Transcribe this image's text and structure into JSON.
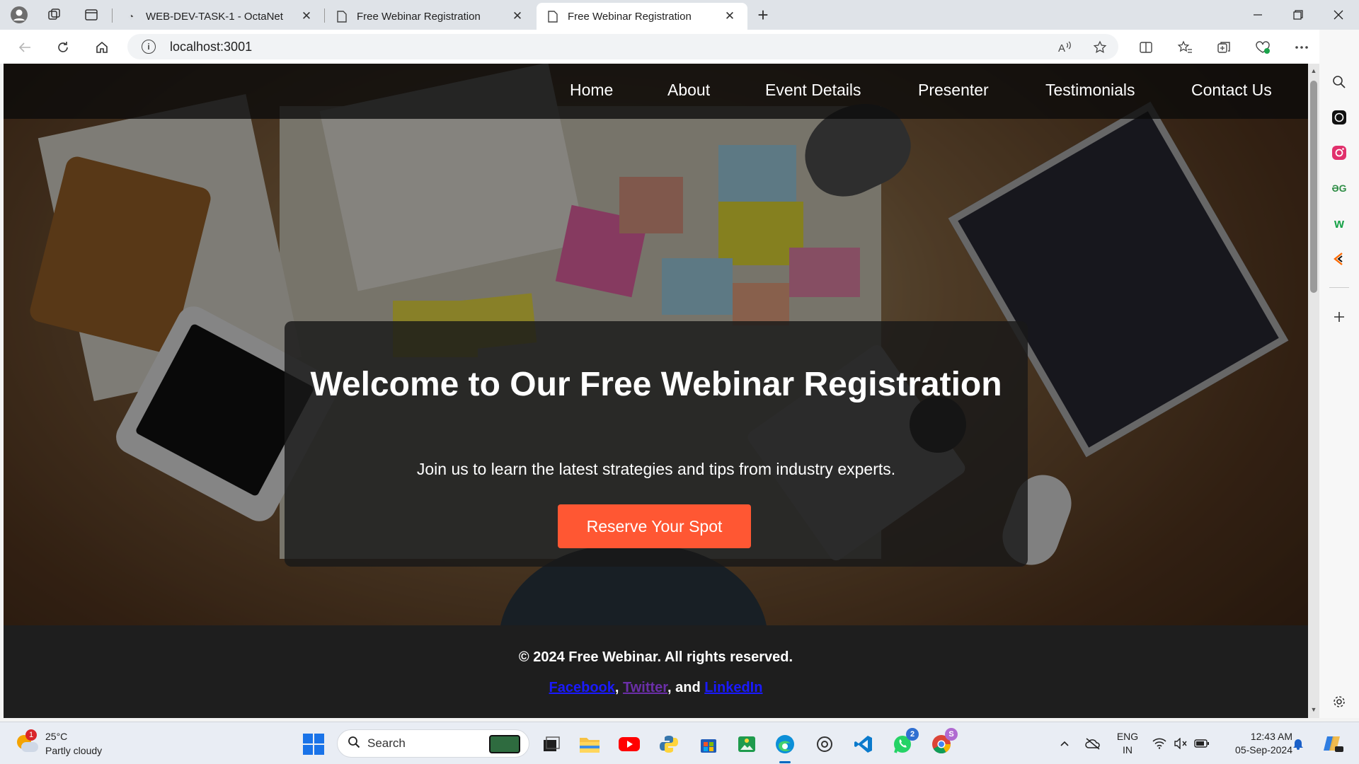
{
  "browser": {
    "tabs": [
      {
        "label": "WEB-DEV-TASK-1 - OctaNet",
        "active": false
      },
      {
        "label": "Free Webinar Registration",
        "active": false
      },
      {
        "label": "Free Webinar Registration",
        "active": true
      }
    ],
    "close_glyph": "✕",
    "new_tab_glyph": "+",
    "url": "localhost:3001"
  },
  "site": {
    "nav": [
      "Home",
      "About",
      "Event Details",
      "Presenter",
      "Testimonials",
      "Contact Us"
    ],
    "hero": {
      "title": "Welcome to Our Free Webinar Registration",
      "subtitle": "Join us to learn the latest strategies and tips from industry experts.",
      "cta": "Reserve Your Spot"
    },
    "footer": {
      "copyright": "© 2024 Free Webinar. All rights reserved.",
      "links": [
        "Facebook",
        "Twitter",
        "LinkedIn"
      ],
      "sep1": ",",
      "sep2": ", and"
    },
    "colors": {
      "cta": "#ff5733",
      "nav_bg": "#0a0a0a",
      "footer_bg": "#1e1e1e"
    }
  },
  "taskbar": {
    "weather": {
      "temp": "25°C",
      "desc": "Partly cloudy",
      "badge": "1"
    },
    "search_placeholder": "Search",
    "lang": {
      "line1": "ENG",
      "line2": "IN"
    },
    "clock": {
      "time": "12:43 AM",
      "date": "05-Sep-2024"
    },
    "whatsapp_badge": "2",
    "chrome_badge": "S"
  }
}
